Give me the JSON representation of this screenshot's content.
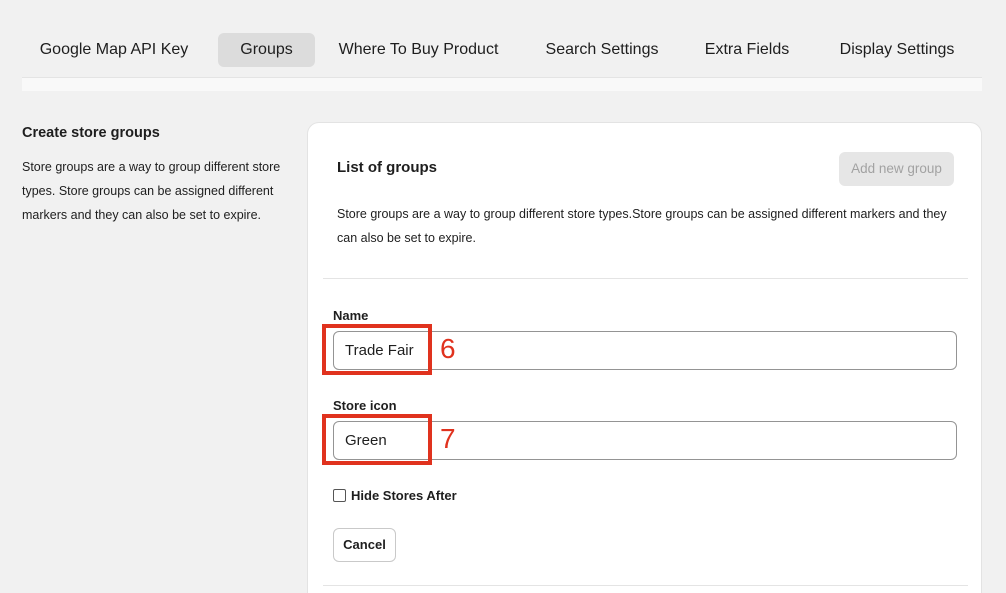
{
  "tabs": [
    {
      "label": "Google Map API Key",
      "active": false
    },
    {
      "label": "Groups",
      "active": true
    },
    {
      "label": "Where To Buy Product",
      "active": false
    },
    {
      "label": "Search Settings",
      "active": false
    },
    {
      "label": "Extra Fields",
      "active": false
    },
    {
      "label": "Display Settings",
      "active": false
    }
  ],
  "sidebar": {
    "title": "Create store groups",
    "description": "Store groups are a way to group different store types. Store groups can be assigned different markers and they can also be set to expire."
  },
  "card": {
    "title": "List of groups",
    "add_button_label": "Add new group",
    "description": "Store groups are a way to group different store types.Store groups can be assigned different markers and they can also be set to expire."
  },
  "form": {
    "name_label": "Name",
    "name_value": "Trade Fair",
    "icon_label": "Store icon",
    "icon_value": "Green",
    "hide_stores_label": "Hide Stores After",
    "hide_stores_checked": false,
    "cancel_label": "Cancel"
  },
  "annotations": {
    "name_marker": "6",
    "icon_marker": "7",
    "color": "#e0321e"
  },
  "colors": {
    "background": "#f1f1f1",
    "active_tab": "#dcdcdc",
    "disabled_button": "#e6e6e6"
  }
}
